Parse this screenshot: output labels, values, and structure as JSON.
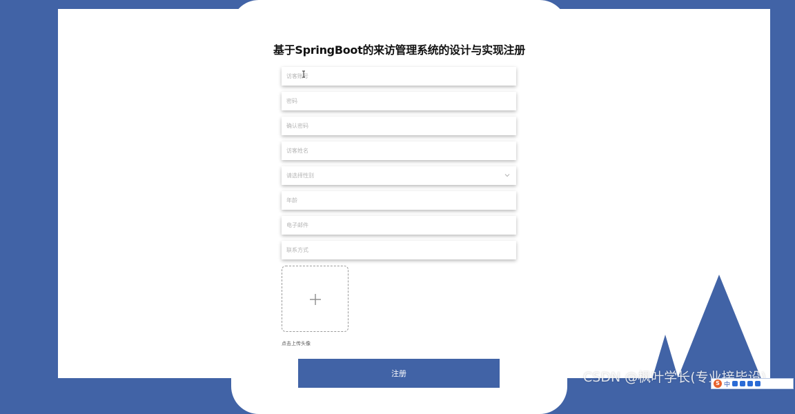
{
  "form": {
    "title": "基于SpringBoot的来访管理系统的设计与实现注册",
    "fields": [
      {
        "placeholder": "访客账号"
      },
      {
        "placeholder": "密码"
      },
      {
        "placeholder": "确认密码"
      },
      {
        "placeholder": "访客姓名"
      },
      {
        "placeholder": "请选择性别"
      },
      {
        "placeholder": "年龄"
      },
      {
        "placeholder": "电子邮件"
      },
      {
        "placeholder": "联系方式"
      }
    ],
    "upload_label": "点击上传头像",
    "register_label": "注册"
  },
  "watermark": "CSDN @枫叶学长(专业接毕设)",
  "ime": {
    "logo": "S",
    "mode": "中"
  },
  "colors": {
    "brand_blue": "#4163a6",
    "background": "#ffffff"
  },
  "icons": {
    "upload": "plus-icon",
    "select": "chevron-down-icon",
    "cursor": "text-cursor-icon"
  }
}
